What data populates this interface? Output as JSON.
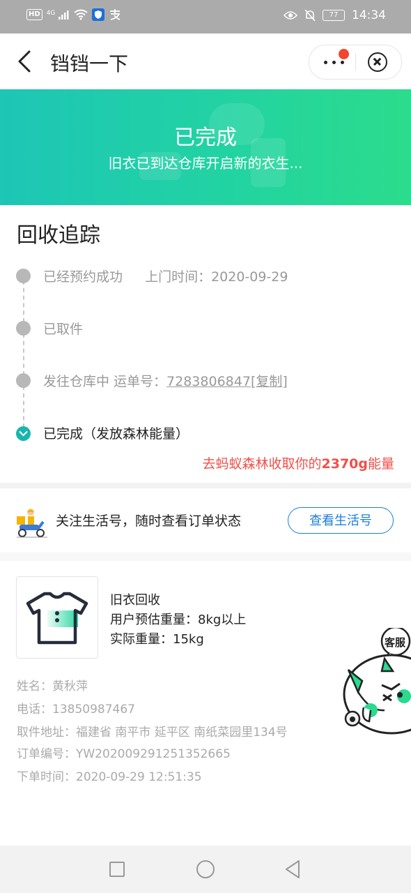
{
  "status_bar": {
    "time": "14:34",
    "battery": "77",
    "network_badge": "HD",
    "signal": "4G",
    "icons": [
      "hd-icon",
      "signal-icon",
      "wifi-icon",
      "shield-app-icon",
      "alipay-icon",
      "eye-icon",
      "mute-icon",
      "battery-icon"
    ]
  },
  "nav": {
    "title": "铛铛一下",
    "icons": [
      "back-arrow-icon",
      "more-dots-icon",
      "close-circle-icon"
    ]
  },
  "banner": {
    "title": "已完成",
    "subtitle": "旧衣已到达仓库开启新的衣生..."
  },
  "tracking": {
    "title": "回收追踪",
    "step1_text": "已经预约成功",
    "step1_time_label": "上门时间：2020-09-29",
    "step2_text": "已取件",
    "step3_text": "发往仓库中 运单号：",
    "step3_waybill": "7283806847",
    "step3_copy": "[复制]",
    "step4_text": "已完成（发放森林能量）",
    "forest_link_prefix": "去蚂蚁森林收取你的",
    "forest_link_amount": "2370g",
    "forest_link_suffix": "能量"
  },
  "follow": {
    "text": "关注生活号，随时查看订单状态",
    "button": "查看生活号"
  },
  "product": {
    "name": "旧衣回收",
    "estimated_weight": "用户预估重量：8kg以上",
    "actual_weight": "实际重量：15kg"
  },
  "order_info": {
    "name": "姓名：黄秋萍",
    "phone": "电话：13850987467",
    "address": "取件地址：福建省 南平市 延平区 南纸菜园里134号",
    "order_no": "订单编号：YW202009291251352665",
    "order_time": "下单时间：2020-09-29 12:51:35"
  },
  "service": {
    "label": "客服"
  },
  "colors": {
    "banner_start": "#1dc6b5",
    "banner_end": "#2bdc8c",
    "accent_blue": "#1a7fdc",
    "energy_red": "#f0504a",
    "check_teal": "#1ab5b0",
    "badge_red": "#f2452e"
  }
}
